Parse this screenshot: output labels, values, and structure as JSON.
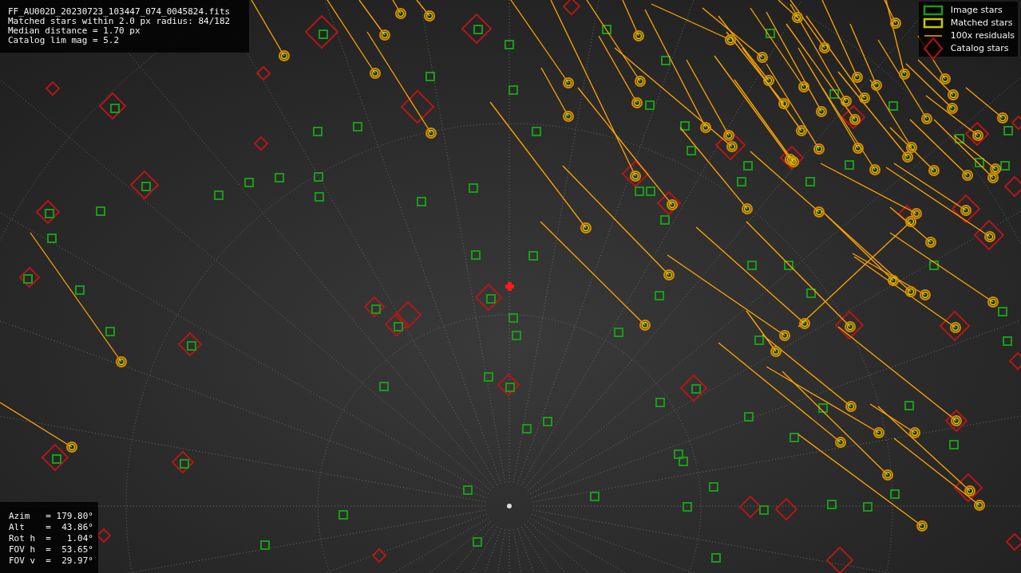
{
  "info": [
    "FF_AU002D_20230723_103447_074_0045824.fits",
    "Matched stars within 2.0 px radius: 84/182",
    "Median distance = 1.70 px",
    "Catalog lim mag = 5.2"
  ],
  "legend": [
    {
      "kind": "image",
      "label": "Image stars"
    },
    {
      "kind": "matched",
      "label": "Matched stars"
    },
    {
      "kind": "residual",
      "label": "100x residuals"
    },
    {
      "kind": "catalog",
      "label": "Catalog stars"
    }
  ],
  "pointing": [
    "Azim   = 179.80°",
    "Alt    =  43.86°",
    "Rot h  =   1.04°",
    "FOV h  =  53.65°",
    "FOV v  =  29.97°"
  ]
}
